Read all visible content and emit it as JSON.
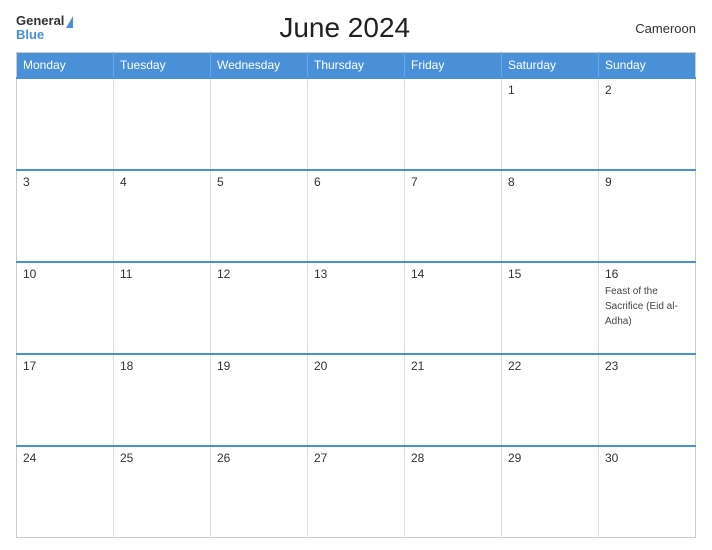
{
  "header": {
    "title": "June 2024",
    "country": "Cameroon",
    "logo": {
      "line1": "General",
      "line2": "Blue",
      "triangle": "▶"
    }
  },
  "calendar": {
    "weekdays": [
      "Monday",
      "Tuesday",
      "Wednesday",
      "Thursday",
      "Friday",
      "Saturday",
      "Sunday"
    ],
    "weeks": [
      [
        {
          "day": "",
          "event": ""
        },
        {
          "day": "",
          "event": ""
        },
        {
          "day": "",
          "event": ""
        },
        {
          "day": "",
          "event": ""
        },
        {
          "day": "",
          "event": ""
        },
        {
          "day": "1",
          "event": ""
        },
        {
          "day": "2",
          "event": ""
        }
      ],
      [
        {
          "day": "3",
          "event": ""
        },
        {
          "day": "4",
          "event": ""
        },
        {
          "day": "5",
          "event": ""
        },
        {
          "day": "6",
          "event": ""
        },
        {
          "day": "7",
          "event": ""
        },
        {
          "day": "8",
          "event": ""
        },
        {
          "day": "9",
          "event": ""
        }
      ],
      [
        {
          "day": "10",
          "event": ""
        },
        {
          "day": "11",
          "event": ""
        },
        {
          "day": "12",
          "event": ""
        },
        {
          "day": "13",
          "event": ""
        },
        {
          "day": "14",
          "event": ""
        },
        {
          "day": "15",
          "event": ""
        },
        {
          "day": "16",
          "event": "Feast of the Sacrifice (Eid al-Adha)"
        }
      ],
      [
        {
          "day": "17",
          "event": ""
        },
        {
          "day": "18",
          "event": ""
        },
        {
          "day": "19",
          "event": ""
        },
        {
          "day": "20",
          "event": ""
        },
        {
          "day": "21",
          "event": ""
        },
        {
          "day": "22",
          "event": ""
        },
        {
          "day": "23",
          "event": ""
        }
      ],
      [
        {
          "day": "24",
          "event": ""
        },
        {
          "day": "25",
          "event": ""
        },
        {
          "day": "26",
          "event": ""
        },
        {
          "day": "27",
          "event": ""
        },
        {
          "day": "28",
          "event": ""
        },
        {
          "day": "29",
          "event": ""
        },
        {
          "day": "30",
          "event": ""
        }
      ]
    ]
  }
}
